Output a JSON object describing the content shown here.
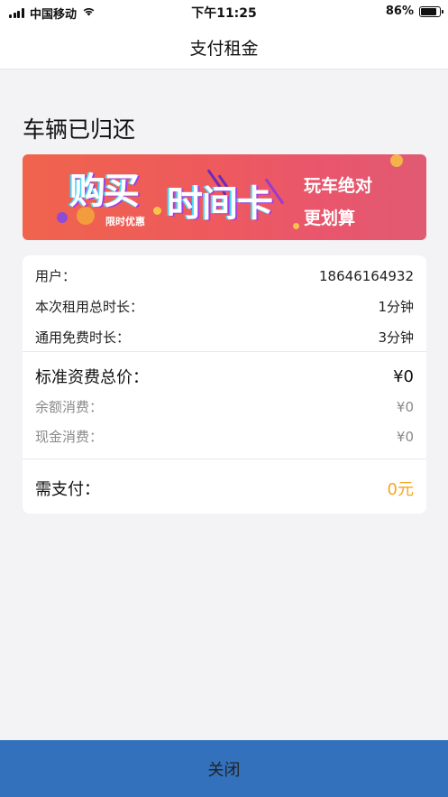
{
  "status_bar": {
    "carrier": "中国移动",
    "time": "下午11:25",
    "battery": "86%",
    "battery_level": 0.86,
    "icons": [
      "signal-icon",
      "wifi-icon",
      "battery-icon"
    ]
  },
  "navbar": {
    "title": "支付租金"
  },
  "heading": "车辆已归还",
  "banner": {
    "title_part1": "购买",
    "title_part2": "时间卡",
    "promo_tag": "限时优惠",
    "slogan_line1": "玩车绝对",
    "slogan_line2": "更划算"
  },
  "details": {
    "user_label": "用户：",
    "user_value": "18646164932",
    "rent_duration_label": "本次租用总时长：",
    "rent_duration_value": "1分钟",
    "free_duration_label": "通用免费时长：",
    "free_duration_value": "3分钟",
    "total_price_label": "标准资费总价：",
    "total_price_value": "¥0",
    "balance_label": "余额消费：",
    "balance_value": "¥0",
    "cash_label": "现金消费：",
    "cash_value": "¥0",
    "pay_label": "需支付：",
    "pay_value": "0元"
  },
  "close_button": "关闭",
  "colors": {
    "accent_pay": "#f5a623",
    "button_bg": "#3371bd",
    "page_bg": "#f3f3f5"
  }
}
